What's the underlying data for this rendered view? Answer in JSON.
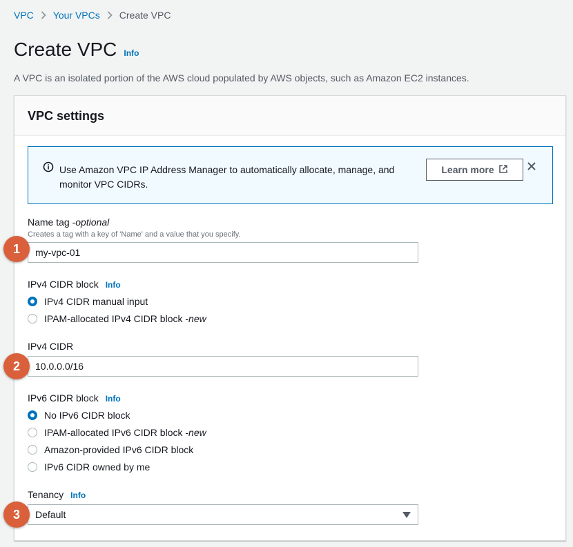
{
  "breadcrumb": {
    "items": [
      {
        "label": "VPC"
      },
      {
        "label": "Your VPCs"
      },
      {
        "label": "Create VPC"
      }
    ]
  },
  "header": {
    "title": "Create VPC",
    "info": "Info",
    "description": "A VPC is an isolated portion of the AWS cloud populated by AWS objects, such as Amazon EC2 instances."
  },
  "panel": {
    "title": "VPC settings",
    "alert": {
      "text": "Use Amazon VPC IP Address Manager to automatically allocate, manage, and monitor VPC CIDRs.",
      "button_label": "Learn more"
    },
    "name_tag": {
      "label": "Name tag - ",
      "optional": "optional",
      "description": "Creates a tag with a key of 'Name' and a value that you specify.",
      "value": "my-vpc-01"
    },
    "ipv4_block": {
      "label": "IPv4 CIDR block",
      "info": "Info",
      "options": [
        {
          "label": "IPv4 CIDR manual input",
          "suffix": "",
          "checked": true
        },
        {
          "label": "IPAM-allocated IPv4 CIDR block - ",
          "suffix": "new",
          "checked": false
        }
      ]
    },
    "ipv4_cidr": {
      "label": "IPv4 CIDR",
      "value": "10.0.0.0/16"
    },
    "ipv6_block": {
      "label": "IPv6 CIDR block",
      "info": "Info",
      "options": [
        {
          "label": "No IPv6 CIDR block",
          "suffix": "",
          "checked": true
        },
        {
          "label": "IPAM-allocated IPv6 CIDR block - ",
          "suffix": "new",
          "checked": false
        },
        {
          "label": "Amazon-provided IPv6 CIDR block",
          "suffix": "",
          "checked": false
        },
        {
          "label": "IPv6 CIDR owned by me",
          "suffix": "",
          "checked": false
        }
      ]
    },
    "tenancy": {
      "label": "Tenancy",
      "info": "Info",
      "value": "Default"
    }
  },
  "step_badges": [
    "1",
    "2",
    "3"
  ],
  "colors": {
    "link": "#0073bb",
    "badge": "#d9603b",
    "alert_bg": "#f1faff",
    "page_bg": "#f2f3f3"
  },
  "icons": {
    "chevron": "chevron-right-icon",
    "info": "info-circle-icon",
    "external": "external-link-icon",
    "close": "close-icon",
    "dropdown": "caret-down-icon"
  }
}
